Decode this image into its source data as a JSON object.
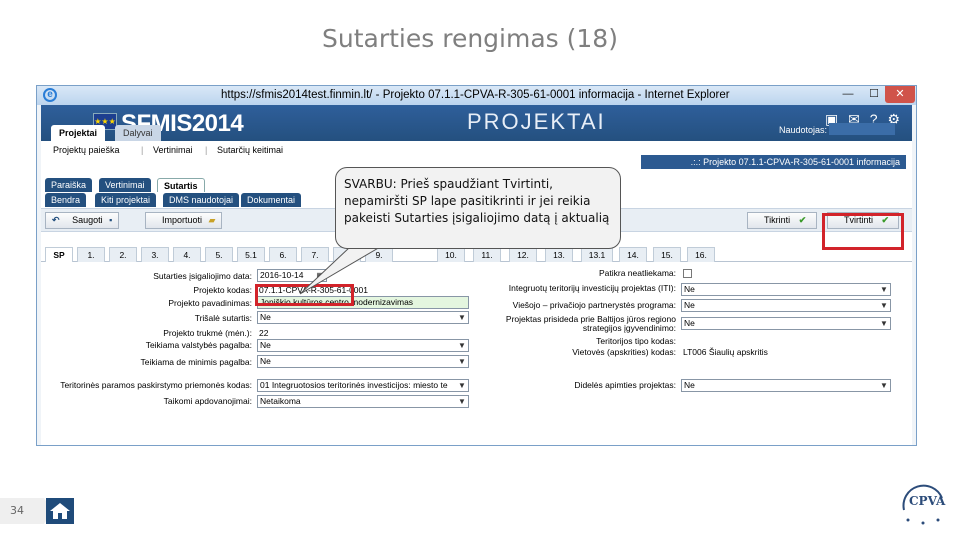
{
  "slide": {
    "title": "Sutarties rengimas (18)",
    "page_number": "34"
  },
  "browser": {
    "url_title": "https://sfmis2014test.finmin.lt/ - Projekto 07.1.1-CPVA-R-305-61-0001 informacija - Internet Explorer",
    "minimize_glyph": "—",
    "maximize_glyph": "☐",
    "close_glyph": "✕"
  },
  "app": {
    "logo": "SFMIS2014",
    "section_title": "PROJEKTAI",
    "user_label": "Naudotojas:",
    "main_tabs": [
      "Projektai",
      "Dalyvai"
    ],
    "subnav": [
      "Projektų paieška",
      "Vertinimai",
      "Sutarčių keitimai"
    ],
    "banner": ".:.: Projekto 07.1.1-CPVA-R-305-61-0001 informacija",
    "tabs_row1": [
      "Paraiška",
      "Vertinimai",
      "Sutartis"
    ],
    "tabs_row2": [
      "Bendra",
      "Kiti projektai",
      "DMS naudotojai",
      "Dokumentai"
    ],
    "toolbar": {
      "save": "Saugoti",
      "import": "Importuoti",
      "check": "Tikrinti",
      "confirm": "Tvirtinti"
    },
    "section_tabs": [
      "SP",
      "1.",
      "2.",
      "3.",
      "4.",
      "5.",
      "5.1",
      "6.",
      "7.",
      "8.",
      "9.",
      "10.",
      "11.",
      "12.",
      "13.",
      "13.1",
      "14.",
      "15.",
      "16."
    ],
    "form_left": [
      {
        "label": "Sutarties įsigaliojimo data:",
        "value": "2016-10-14"
      },
      {
        "label": "Projekto kodas:",
        "value": "07.1.1-CPVA-R-305-61-0001"
      },
      {
        "label": "Projekto pavadinimas:",
        "value": "Joniškio kultūros centro modernizavimas"
      },
      {
        "label": "Trišalė sutartis:",
        "value": "Ne"
      },
      {
        "label": "Projekto trukmė (mėn.):",
        "value": "22"
      },
      {
        "label": "Teikiama valstybės pagalba:",
        "value": "Ne"
      },
      {
        "label": "Teikiama de minimis pagalba:",
        "value": "Ne"
      },
      {
        "label": "Teritorinės paramos paskirstymo priemonės kodas:",
        "value": "01 Integruotosios teritorinės investicijos: miesto te"
      },
      {
        "label": "Taikomi apdovanojimai:",
        "value": "Netaikoma"
      }
    ],
    "form_right": [
      {
        "label": "Patikra neatliekama:",
        "value": ""
      },
      {
        "label": "Integruotų teritorijų investicijų projektas (ITI):",
        "value": "Ne"
      },
      {
        "label": "Viešojo – privačiojo partnerystės programa:",
        "value": "Ne"
      },
      {
        "label": "Projektas prisideda prie Baltijos jūros regiono strategijos įgyvendinimo:",
        "value": "Ne"
      },
      {
        "label": "Teritorijos tipo kodas:",
        "value": ""
      },
      {
        "label": "Vietovės (apskrities) kodas:",
        "value": "LT006 Šiaulių apskritis"
      },
      {
        "label": "Didelės apimties projektas:",
        "value": "Ne"
      }
    ]
  },
  "callout": {
    "bold": "SVARBU:",
    "text": " Prieš spaudžiant Tvirtinti, nepamiršti SP lape pasitikrinti ir jei reikia pakeisti Sutarties įsigaliojimo datą į aktualią"
  },
  "logo_text": "CPVA",
  "colors": {
    "header_blue": "#2f5f9b",
    "highlight_red": "#d2232a",
    "title_gray": "#7f7f7f"
  }
}
